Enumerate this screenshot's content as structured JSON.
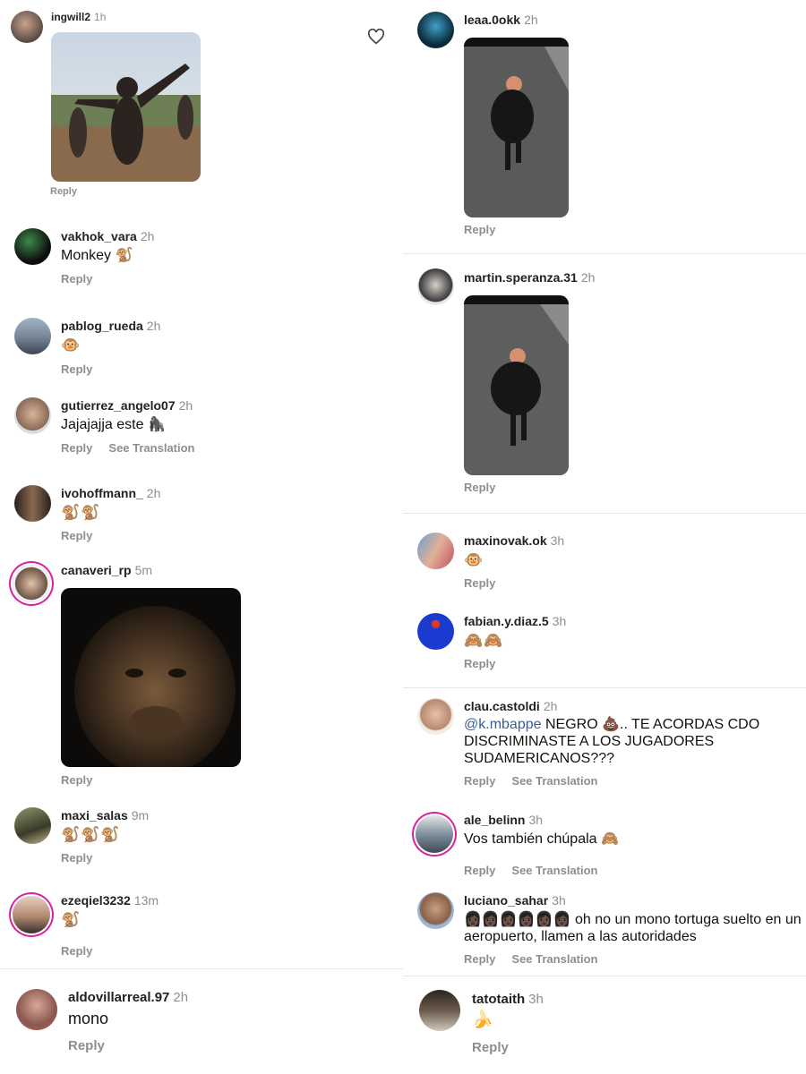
{
  "left": [
    {
      "user": "ingwill2",
      "time": "1h",
      "reply": "Reply"
    },
    {
      "user": "vakhok_vara",
      "time": "2h",
      "text": "Monkey 🐒",
      "reply": "Reply"
    },
    {
      "user": "pablog_rueda",
      "time": "2h",
      "text": "🐵",
      "reply": "Reply"
    },
    {
      "user": "gutierrez_angelo07",
      "time": "2h",
      "text": "Jajajajja este 🦍",
      "reply": "Reply",
      "translate": "See Translation"
    },
    {
      "user": "ivohoffmann_",
      "time": "2h",
      "text": "🐒🐒",
      "reply": "Reply"
    },
    {
      "user": "canaveri_rp",
      "time": "5m",
      "reply": "Reply"
    },
    {
      "user": "maxi_salas",
      "time": "9m",
      "text": "🐒🐒🐒",
      "reply": "Reply"
    },
    {
      "user": "ezeqiel3232",
      "time": "13m",
      "text": "🐒",
      "reply": "Reply"
    },
    {
      "user": "aldovillarreal.97",
      "time": "2h",
      "text": "mono",
      "reply": "Reply"
    }
  ],
  "right": [
    {
      "user": "leaa.0okk",
      "time": "2h",
      "reply": "Reply"
    },
    {
      "user": "martin.speranza.31",
      "time": "2h",
      "reply": "Reply"
    },
    {
      "user": "maxinovak.ok",
      "time": "3h",
      "text": "🐵",
      "reply": "Reply"
    },
    {
      "user": "fabian.y.diaz.5",
      "time": "3h",
      "text": "🙈🙈",
      "reply": "Reply"
    },
    {
      "user": "clau.castoldi",
      "time": "2h",
      "mention": "@k.mbappe",
      "text": " NEGRO 💩.. TE ACORDAS CDO DISCRIMINASTE A LOS JUGADORES SUDAMERICANOS???",
      "reply": "Reply",
      "translate": "See Translation"
    },
    {
      "user": "ale_belinn",
      "time": "3h",
      "text": "Vos también chúpala 🙈",
      "reply": "Reply",
      "translate": "See Translation"
    },
    {
      "user": "luciano_sahar",
      "time": "3h",
      "text": "👩🏿👩🏿👩🏿👩🏿👩🏿👩🏿 oh no un mono tortuga suelto en un aeropuerto, llamen a las autoridades",
      "reply": "Reply",
      "translate": "See Translation"
    },
    {
      "user": "tatotaith",
      "time": "3h",
      "text": "🍌",
      "reply": "Reply"
    }
  ],
  "icons": {
    "like": "heart-outline-icon"
  },
  "colors": {
    "username": "#222222",
    "meta": "#8e8e8e",
    "mention": "#3b5c9a",
    "story_ring": "#d6249f"
  }
}
